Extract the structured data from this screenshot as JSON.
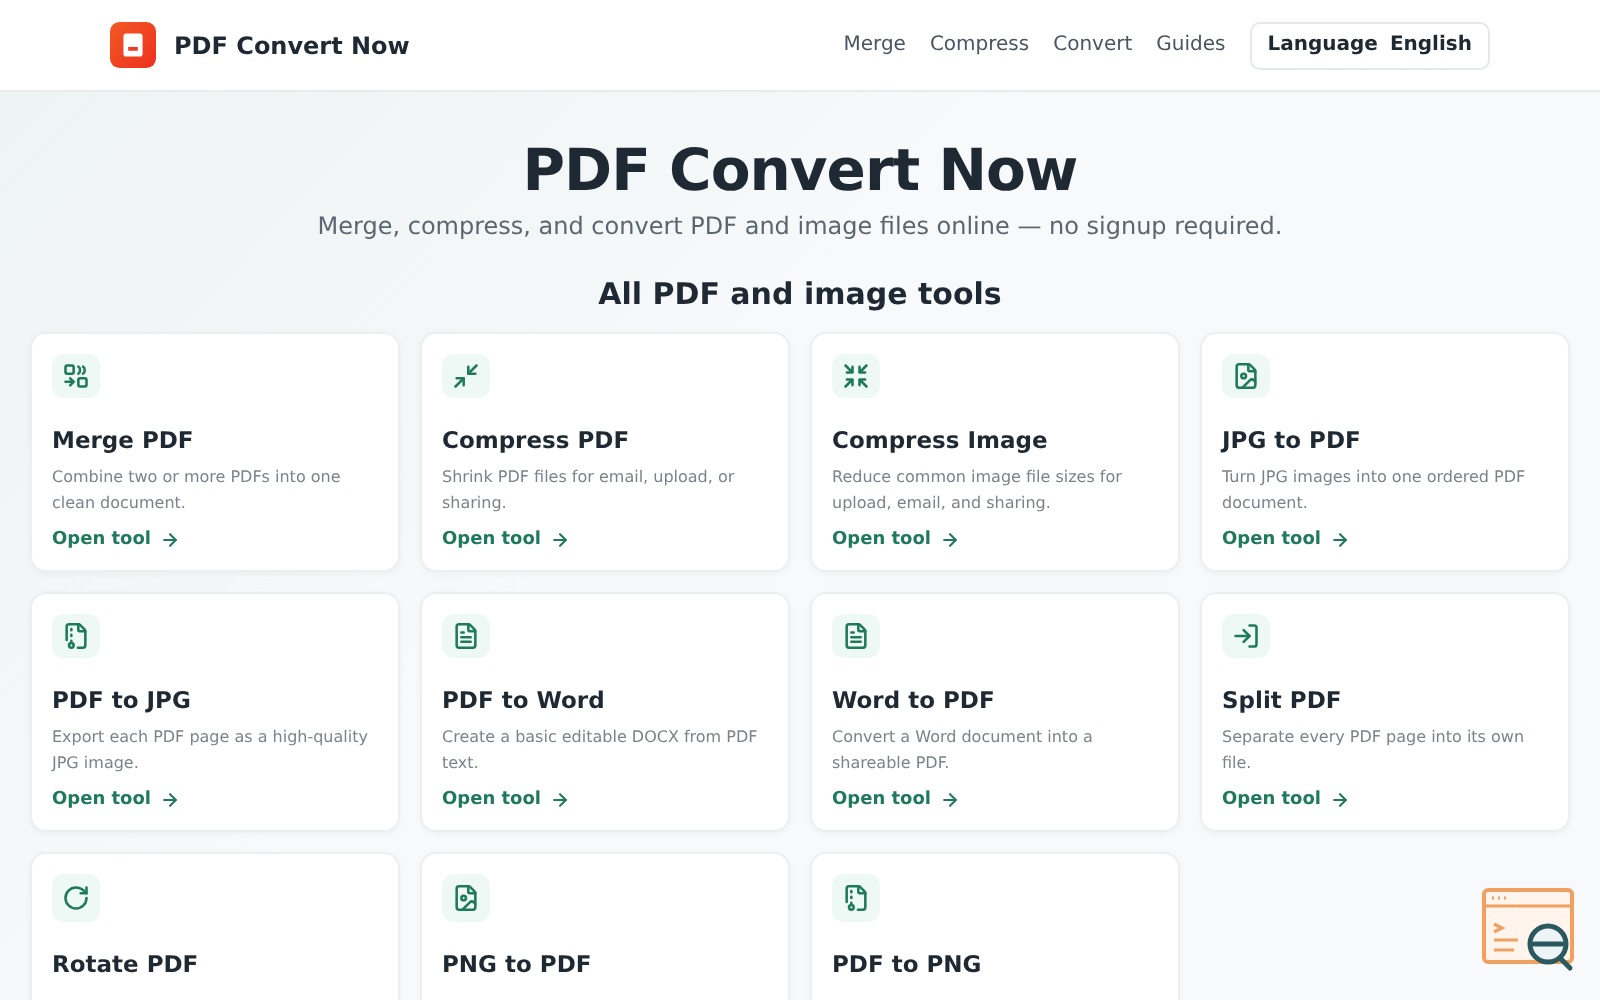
{
  "header": {
    "brand": "PDF Convert Now",
    "nav": [
      {
        "label": "Merge"
      },
      {
        "label": "Compress"
      },
      {
        "label": "Convert"
      },
      {
        "label": "Guides"
      }
    ],
    "language": {
      "label": "Language",
      "value": "English"
    }
  },
  "hero": {
    "title": "PDF Convert Now",
    "subtitle": "Merge, compress, and convert PDF and image files online — no signup required."
  },
  "tools_heading": "All PDF and image tools",
  "tools": [
    {
      "title": "Merge PDF",
      "description": "Combine two or more PDFs into one clean document.",
      "link": "Open tool"
    },
    {
      "title": "Compress PDF",
      "description": "Shrink PDF files for email, upload, or sharing.",
      "link": "Open tool"
    },
    {
      "title": "Compress Image",
      "description": "Reduce common image file sizes for upload, email, and sharing.",
      "link": "Open tool"
    },
    {
      "title": "JPG to PDF",
      "description": "Turn JPG images into one ordered PDF document.",
      "link": "Open tool"
    },
    {
      "title": "PDF to JPG",
      "description": "Export each PDF page as a high-quality JPG image.",
      "link": "Open tool"
    },
    {
      "title": "PDF to Word",
      "description": "Create a basic editable DOCX from PDF text.",
      "link": "Open tool"
    },
    {
      "title": "Word to PDF",
      "description": "Convert a Word document into a shareable PDF.",
      "link": "Open tool"
    },
    {
      "title": "Split PDF",
      "description": "Separate every PDF page into its own file.",
      "link": "Open tool"
    },
    {
      "title": "Rotate PDF"
    },
    {
      "title": "PNG to PDF"
    },
    {
      "title": "PDF to PNG"
    }
  ]
}
